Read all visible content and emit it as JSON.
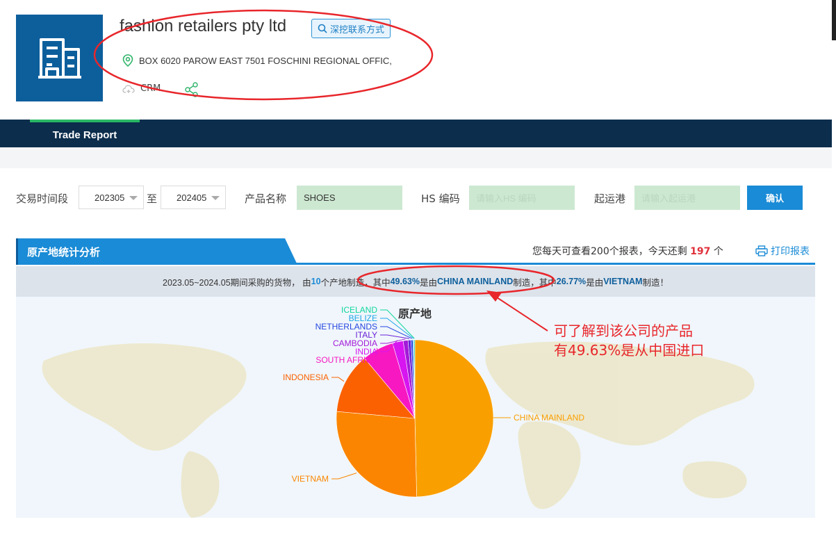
{
  "header": {
    "company_name": "fashion retailers pty ltd",
    "dig_button": "深挖联系方式",
    "address": "BOX 6020 PAROW EAST 7501 FOSCHINI REGIONAL OFFIC,",
    "crm_label": "CRM",
    "logo_icon": "building-icon"
  },
  "nav": {
    "tabs": [
      {
        "label": "Trade Report",
        "active": true
      }
    ]
  },
  "filters": {
    "period_label": "交易时间段",
    "period_from": "202305",
    "to_label": "至",
    "period_to": "202405",
    "product_label": "产品名称",
    "product_value": "SHOES",
    "hs_label": "HS 编码",
    "hs_placeholder": "请输入HS 编码",
    "port_label": "起运港",
    "port_placeholder": "请输入起运港",
    "confirm_label": "确认"
  },
  "section": {
    "title": "原产地统计分析",
    "quota_prefix": "您每天可查看200个报表，今天还剩 ",
    "quota_remaining": "197",
    "quota_suffix": " 个",
    "print_label": "打印报表"
  },
  "summary": {
    "part1": "2023.05~2024.05期间采购的货物，  由",
    "origin_count": "10",
    "part2": "个产地制造，其中",
    "pct1": "49.63%",
    "part3": "是由",
    "country1": "CHINA MAINLAND",
    "part4": "制造，其中",
    "pct2": "26.77%",
    "part5": "是由",
    "country2": "VIETNAM",
    "part6": "制造！"
  },
  "annotation": {
    "line1": "可了解到该公司的产品",
    "line2": "有49.63%是从中国进口"
  },
  "colors": {
    "brand_blue": "#1a8bd6",
    "nav_dark": "#0c2d4c",
    "annotation_red": "#e8262b",
    "input_green": "#cde8d1"
  },
  "chart_data": {
    "type": "pie",
    "title": "原产地",
    "slices": [
      {
        "label": "CHINA MAINLAND",
        "value": 49.63,
        "color": "#fa9f00"
      },
      {
        "label": "VIETNAM",
        "value": 26.77,
        "color": "#fb8500"
      },
      {
        "label": "INDONESIA",
        "value": 12.5,
        "color": "#fb6100"
      },
      {
        "label": "SOUTH AFRICA",
        "value": 6.5,
        "color": "#f718c2"
      },
      {
        "label": "INDIA",
        "value": 2.2,
        "color": "#d715f0"
      },
      {
        "label": "CAMBODIA",
        "value": 1.0,
        "color": "#a31ad8"
      },
      {
        "label": "ITALY",
        "value": 0.6,
        "color": "#6a21d8"
      },
      {
        "label": "NETHERLANDS",
        "value": 0.4,
        "color": "#2647e0"
      },
      {
        "label": "BELIZE",
        "value": 0.2,
        "color": "#1fa6e8"
      },
      {
        "label": "ICELAND",
        "value": 0.2,
        "color": "#10d6a0"
      }
    ]
  }
}
